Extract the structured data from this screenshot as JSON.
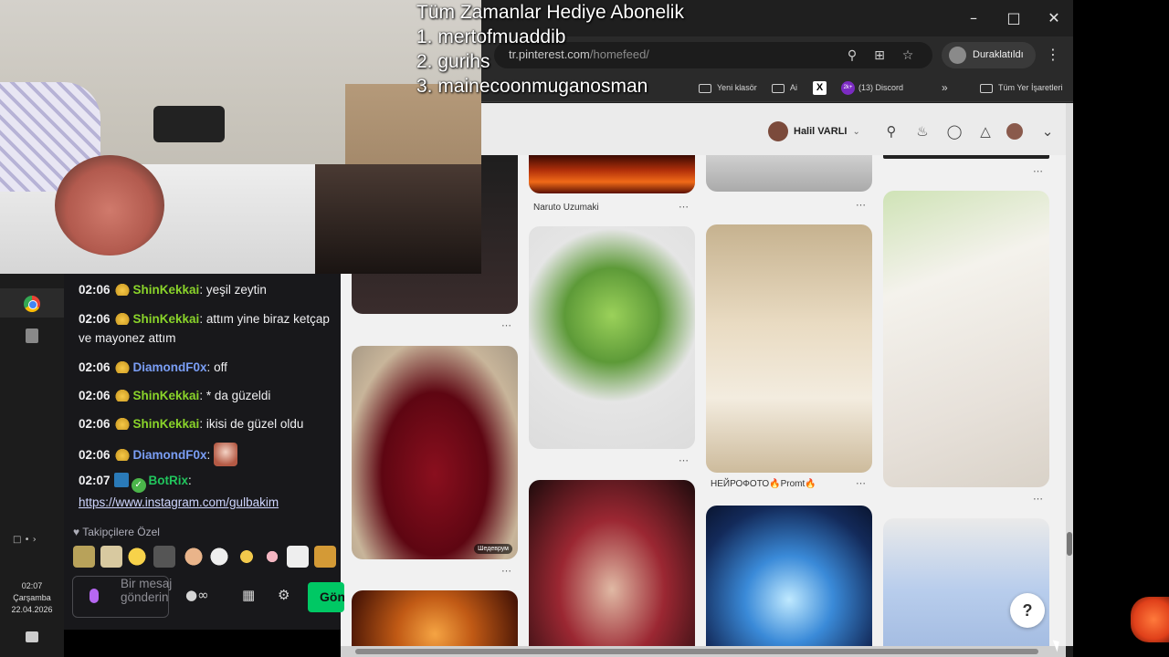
{
  "overlay": {
    "title": "Tüm Zamanlar Hediye  Abonelik",
    "lines": [
      "1. mertofmuaddib",
      "2. gurihs",
      "3. mainecoonmuganosman"
    ]
  },
  "browser": {
    "url_host": "tr.pinterest.com",
    "url_path": "/homefeed/",
    "paused_label": "Duraklatıldı",
    "bookmarks": [
      {
        "label": "Yeni klasör"
      },
      {
        "label": "Ai"
      },
      {
        "label": "(13) Discord",
        "badge": "2k+"
      },
      {
        "label": "Tüm Yer İşaretleri"
      }
    ],
    "icons": [
      "zoom-icon",
      "install-icon",
      "star-icon",
      "kebab-menu-icon"
    ]
  },
  "pinterest": {
    "user_name": "Halil VARLI",
    "pins": [
      {
        "title": "Naruto Uzumaki"
      },
      {
        "title": "НЕЙРОФОТО🔥Promt🔥"
      },
      {
        "watermark": "Шедеврум"
      }
    ],
    "help_label": "?"
  },
  "chat": {
    "messages": [
      {
        "time": "02:06",
        "user": "ShinKekkai",
        "text": "yeşil zeytin",
        "color": "#8ad42a"
      },
      {
        "time": "02:06",
        "user": "ShinKekkai",
        "text": "attım yine biraz ketçap ve mayonez attım",
        "color": "#8ad42a"
      },
      {
        "time": "02:06",
        "user": "DiamondF0x",
        "text": "off",
        "color": "#7a9ef5"
      },
      {
        "time": "02:06",
        "user": "ShinKekkai",
        "text": "* da güzeldi",
        "color": "#8ad42a"
      },
      {
        "time": "02:06",
        "user": "ShinKekkai",
        "text": "ikisi de güzel oldu",
        "color": "#8ad42a"
      },
      {
        "time": "02:06",
        "user": "DiamondF0x",
        "text": "",
        "color": "#7a9ef5"
      },
      {
        "time": "02:07",
        "user": "BotRix",
        "text": "https://www.instagram.com/gulbakim",
        "color": "#21c55d"
      }
    ],
    "followers_only": "Takipçilere Özel",
    "input_placeholder": "Bir mesaj gönderin",
    "send_label": "Gönder"
  },
  "taskbar": {
    "time": "02:07",
    "day": "Çarşamba",
    "date": "22.04.2026"
  }
}
